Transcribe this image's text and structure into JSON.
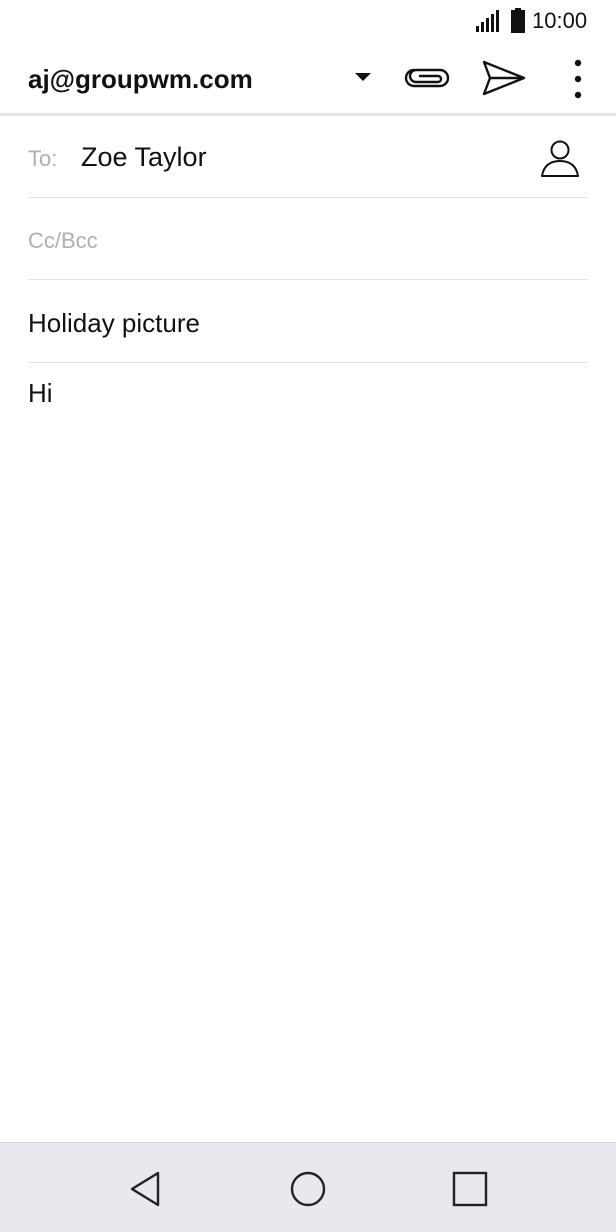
{
  "status_bar": {
    "time": "10:00",
    "icons": [
      "signal-icon",
      "battery-icon"
    ]
  },
  "app_bar": {
    "account": "aj@groupwm.com",
    "icons": [
      "chevron-down-icon",
      "paperclip-icon",
      "send-icon",
      "more-vert-icon"
    ]
  },
  "compose": {
    "to_label": "To:",
    "to_value": "Zoe Taylor",
    "cc_placeholder": "Cc/Bcc",
    "subject": "Holiday picture",
    "body": "Hi"
  },
  "nav_bar": {
    "icons": [
      "back-icon",
      "home-icon",
      "recents-icon"
    ]
  },
  "colors": {
    "background": "#ffffff",
    "text": "#111111",
    "hint": "#b0b0b0",
    "divider": "#e2e2e2",
    "nav_background": "#e8e9ee"
  }
}
